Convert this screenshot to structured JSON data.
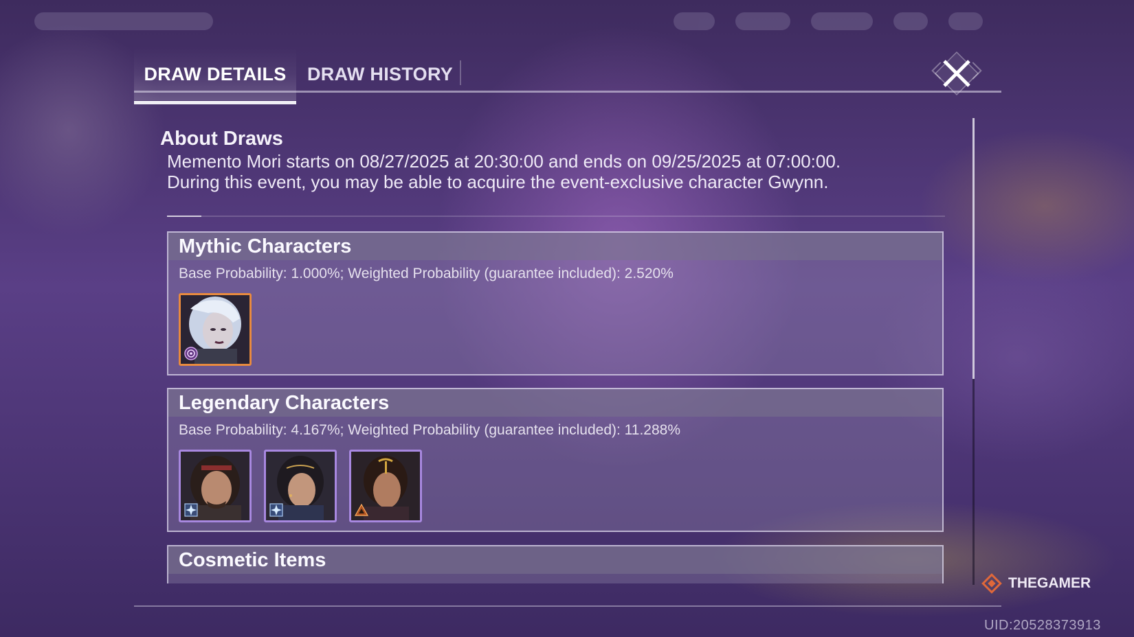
{
  "tabs": [
    {
      "label": "DRAW DETAILS"
    },
    {
      "label": "DRAW HISTORY"
    }
  ],
  "close_button": {
    "icon": "close-icon"
  },
  "about": {
    "title": "About Draws",
    "line1": "Memento Mori starts on 08/27/2025 at 20:30:00 and ends on 09/25/2025 at 07:00:00.",
    "line2": "During this event, you may be able to acquire the event-exclusive character Gwynn."
  },
  "sections": [
    {
      "title": "Mythic Characters",
      "probability": "Base Probability: 1.000%; Weighted Probability (guarantee included): 2.520%",
      "portraits": [
        {
          "badge": "spiral-badge-icon",
          "frame_color": "#e88a3e"
        }
      ]
    },
    {
      "title": "Legendary Characters",
      "probability": "Base Probability: 4.167%; Weighted Probability (guarantee included): 11.288%",
      "portraits": [
        {
          "badge": "star-badge-icon",
          "frame_color": "#a888e0"
        },
        {
          "badge": "star-badge-icon",
          "frame_color": "#a888e0"
        },
        {
          "badge": "triangle-badge-icon",
          "frame_color": "#a888e0"
        }
      ]
    },
    {
      "title": "Cosmetic Items"
    }
  ],
  "watermark": {
    "text": "THEGAMER"
  },
  "uid": "UID:20528373913"
}
